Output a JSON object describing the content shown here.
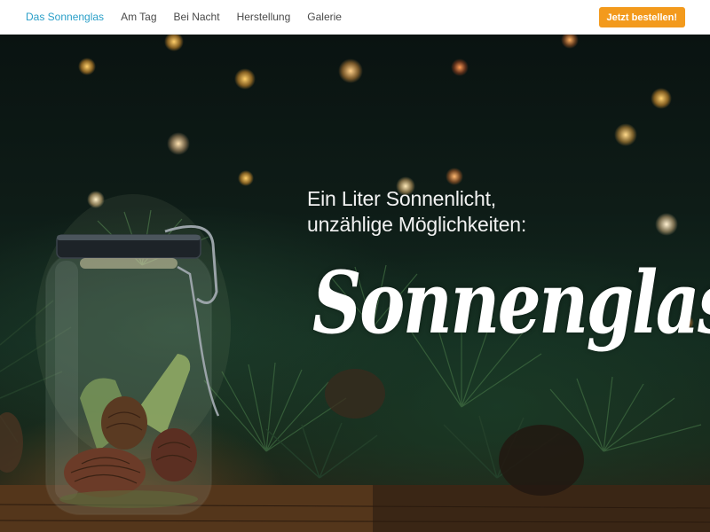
{
  "nav": {
    "items": [
      {
        "label": "Das Sonnenglas",
        "active": true
      },
      {
        "label": "Am Tag",
        "active": false
      },
      {
        "label": "Bei Nacht",
        "active": false
      },
      {
        "label": "Herstellung",
        "active": false
      },
      {
        "label": "Galerie",
        "active": false
      }
    ],
    "cta_label": "Jetzt bestellen!"
  },
  "hero": {
    "tagline_line1": "Ein Liter Sonnenlicht,",
    "tagline_line2": "unzählige Möglichkeiten:",
    "logo_text": "Sonnenglas"
  },
  "colors": {
    "accent_link": "#2a9fc8",
    "cta_background": "#f39a1c",
    "nav_text": "#4a4a4a",
    "hero_text": "#ffffff"
  }
}
